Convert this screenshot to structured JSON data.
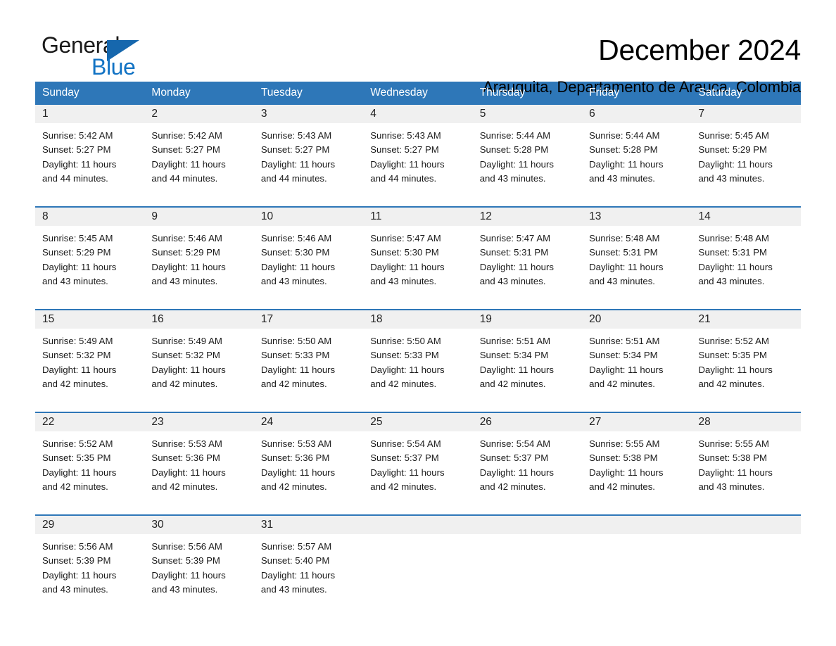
{
  "brand": {
    "name_part1": "General",
    "name_part2": "Blue",
    "accent_color": "#1273c4",
    "triangle_color": "#1667ad"
  },
  "header": {
    "month_title": "December 2024",
    "location": "Arauquita, Departamento de Arauca, Colombia"
  },
  "calendar": {
    "header_color": "#2e77b8",
    "date_strip_color": "#f0f0f0",
    "weekdays": [
      "Sunday",
      "Monday",
      "Tuesday",
      "Wednesday",
      "Thursday",
      "Friday",
      "Saturday"
    ],
    "weeks": [
      {
        "dates": [
          "1",
          "2",
          "3",
          "4",
          "5",
          "6",
          "7"
        ],
        "cells": [
          {
            "sunrise": "Sunrise: 5:42 AM",
            "sunset": "Sunset: 5:27 PM",
            "daylight1": "Daylight: 11 hours",
            "daylight2": "and 44 minutes."
          },
          {
            "sunrise": "Sunrise: 5:42 AM",
            "sunset": "Sunset: 5:27 PM",
            "daylight1": "Daylight: 11 hours",
            "daylight2": "and 44 minutes."
          },
          {
            "sunrise": "Sunrise: 5:43 AM",
            "sunset": "Sunset: 5:27 PM",
            "daylight1": "Daylight: 11 hours",
            "daylight2": "and 44 minutes."
          },
          {
            "sunrise": "Sunrise: 5:43 AM",
            "sunset": "Sunset: 5:27 PM",
            "daylight1": "Daylight: 11 hours",
            "daylight2": "and 44 minutes."
          },
          {
            "sunrise": "Sunrise: 5:44 AM",
            "sunset": "Sunset: 5:28 PM",
            "daylight1": "Daylight: 11 hours",
            "daylight2": "and 43 minutes."
          },
          {
            "sunrise": "Sunrise: 5:44 AM",
            "sunset": "Sunset: 5:28 PM",
            "daylight1": "Daylight: 11 hours",
            "daylight2": "and 43 minutes."
          },
          {
            "sunrise": "Sunrise: 5:45 AM",
            "sunset": "Sunset: 5:29 PM",
            "daylight1": "Daylight: 11 hours",
            "daylight2": "and 43 minutes."
          }
        ]
      },
      {
        "dates": [
          "8",
          "9",
          "10",
          "11",
          "12",
          "13",
          "14"
        ],
        "cells": [
          {
            "sunrise": "Sunrise: 5:45 AM",
            "sunset": "Sunset: 5:29 PM",
            "daylight1": "Daylight: 11 hours",
            "daylight2": "and 43 minutes."
          },
          {
            "sunrise": "Sunrise: 5:46 AM",
            "sunset": "Sunset: 5:29 PM",
            "daylight1": "Daylight: 11 hours",
            "daylight2": "and 43 minutes."
          },
          {
            "sunrise": "Sunrise: 5:46 AM",
            "sunset": "Sunset: 5:30 PM",
            "daylight1": "Daylight: 11 hours",
            "daylight2": "and 43 minutes."
          },
          {
            "sunrise": "Sunrise: 5:47 AM",
            "sunset": "Sunset: 5:30 PM",
            "daylight1": "Daylight: 11 hours",
            "daylight2": "and 43 minutes."
          },
          {
            "sunrise": "Sunrise: 5:47 AM",
            "sunset": "Sunset: 5:31 PM",
            "daylight1": "Daylight: 11 hours",
            "daylight2": "and 43 minutes."
          },
          {
            "sunrise": "Sunrise: 5:48 AM",
            "sunset": "Sunset: 5:31 PM",
            "daylight1": "Daylight: 11 hours",
            "daylight2": "and 43 minutes."
          },
          {
            "sunrise": "Sunrise: 5:48 AM",
            "sunset": "Sunset: 5:31 PM",
            "daylight1": "Daylight: 11 hours",
            "daylight2": "and 43 minutes."
          }
        ]
      },
      {
        "dates": [
          "15",
          "16",
          "17",
          "18",
          "19",
          "20",
          "21"
        ],
        "cells": [
          {
            "sunrise": "Sunrise: 5:49 AM",
            "sunset": "Sunset: 5:32 PM",
            "daylight1": "Daylight: 11 hours",
            "daylight2": "and 42 minutes."
          },
          {
            "sunrise": "Sunrise: 5:49 AM",
            "sunset": "Sunset: 5:32 PM",
            "daylight1": "Daylight: 11 hours",
            "daylight2": "and 42 minutes."
          },
          {
            "sunrise": "Sunrise: 5:50 AM",
            "sunset": "Sunset: 5:33 PM",
            "daylight1": "Daylight: 11 hours",
            "daylight2": "and 42 minutes."
          },
          {
            "sunrise": "Sunrise: 5:50 AM",
            "sunset": "Sunset: 5:33 PM",
            "daylight1": "Daylight: 11 hours",
            "daylight2": "and 42 minutes."
          },
          {
            "sunrise": "Sunrise: 5:51 AM",
            "sunset": "Sunset: 5:34 PM",
            "daylight1": "Daylight: 11 hours",
            "daylight2": "and 42 minutes."
          },
          {
            "sunrise": "Sunrise: 5:51 AM",
            "sunset": "Sunset: 5:34 PM",
            "daylight1": "Daylight: 11 hours",
            "daylight2": "and 42 minutes."
          },
          {
            "sunrise": "Sunrise: 5:52 AM",
            "sunset": "Sunset: 5:35 PM",
            "daylight1": "Daylight: 11 hours",
            "daylight2": "and 42 minutes."
          }
        ]
      },
      {
        "dates": [
          "22",
          "23",
          "24",
          "25",
          "26",
          "27",
          "28"
        ],
        "cells": [
          {
            "sunrise": "Sunrise: 5:52 AM",
            "sunset": "Sunset: 5:35 PM",
            "daylight1": "Daylight: 11 hours",
            "daylight2": "and 42 minutes."
          },
          {
            "sunrise": "Sunrise: 5:53 AM",
            "sunset": "Sunset: 5:36 PM",
            "daylight1": "Daylight: 11 hours",
            "daylight2": "and 42 minutes."
          },
          {
            "sunrise": "Sunrise: 5:53 AM",
            "sunset": "Sunset: 5:36 PM",
            "daylight1": "Daylight: 11 hours",
            "daylight2": "and 42 minutes."
          },
          {
            "sunrise": "Sunrise: 5:54 AM",
            "sunset": "Sunset: 5:37 PM",
            "daylight1": "Daylight: 11 hours",
            "daylight2": "and 42 minutes."
          },
          {
            "sunrise": "Sunrise: 5:54 AM",
            "sunset": "Sunset: 5:37 PM",
            "daylight1": "Daylight: 11 hours",
            "daylight2": "and 42 minutes."
          },
          {
            "sunrise": "Sunrise: 5:55 AM",
            "sunset": "Sunset: 5:38 PM",
            "daylight1": "Daylight: 11 hours",
            "daylight2": "and 42 minutes."
          },
          {
            "sunrise": "Sunrise: 5:55 AM",
            "sunset": "Sunset: 5:38 PM",
            "daylight1": "Daylight: 11 hours",
            "daylight2": "and 43 minutes."
          }
        ]
      },
      {
        "dates": [
          "29",
          "30",
          "31",
          "",
          "",
          "",
          ""
        ],
        "cells": [
          {
            "sunrise": "Sunrise: 5:56 AM",
            "sunset": "Sunset: 5:39 PM",
            "daylight1": "Daylight: 11 hours",
            "daylight2": "and 43 minutes."
          },
          {
            "sunrise": "Sunrise: 5:56 AM",
            "sunset": "Sunset: 5:39 PM",
            "daylight1": "Daylight: 11 hours",
            "daylight2": "and 43 minutes."
          },
          {
            "sunrise": "Sunrise: 5:57 AM",
            "sunset": "Sunset: 5:40 PM",
            "daylight1": "Daylight: 11 hours",
            "daylight2": "and 43 minutes."
          },
          {
            "sunrise": "",
            "sunset": "",
            "daylight1": "",
            "daylight2": ""
          },
          {
            "sunrise": "",
            "sunset": "",
            "daylight1": "",
            "daylight2": ""
          },
          {
            "sunrise": "",
            "sunset": "",
            "daylight1": "",
            "daylight2": ""
          },
          {
            "sunrise": "",
            "sunset": "",
            "daylight1": "",
            "daylight2": ""
          }
        ]
      }
    ]
  }
}
